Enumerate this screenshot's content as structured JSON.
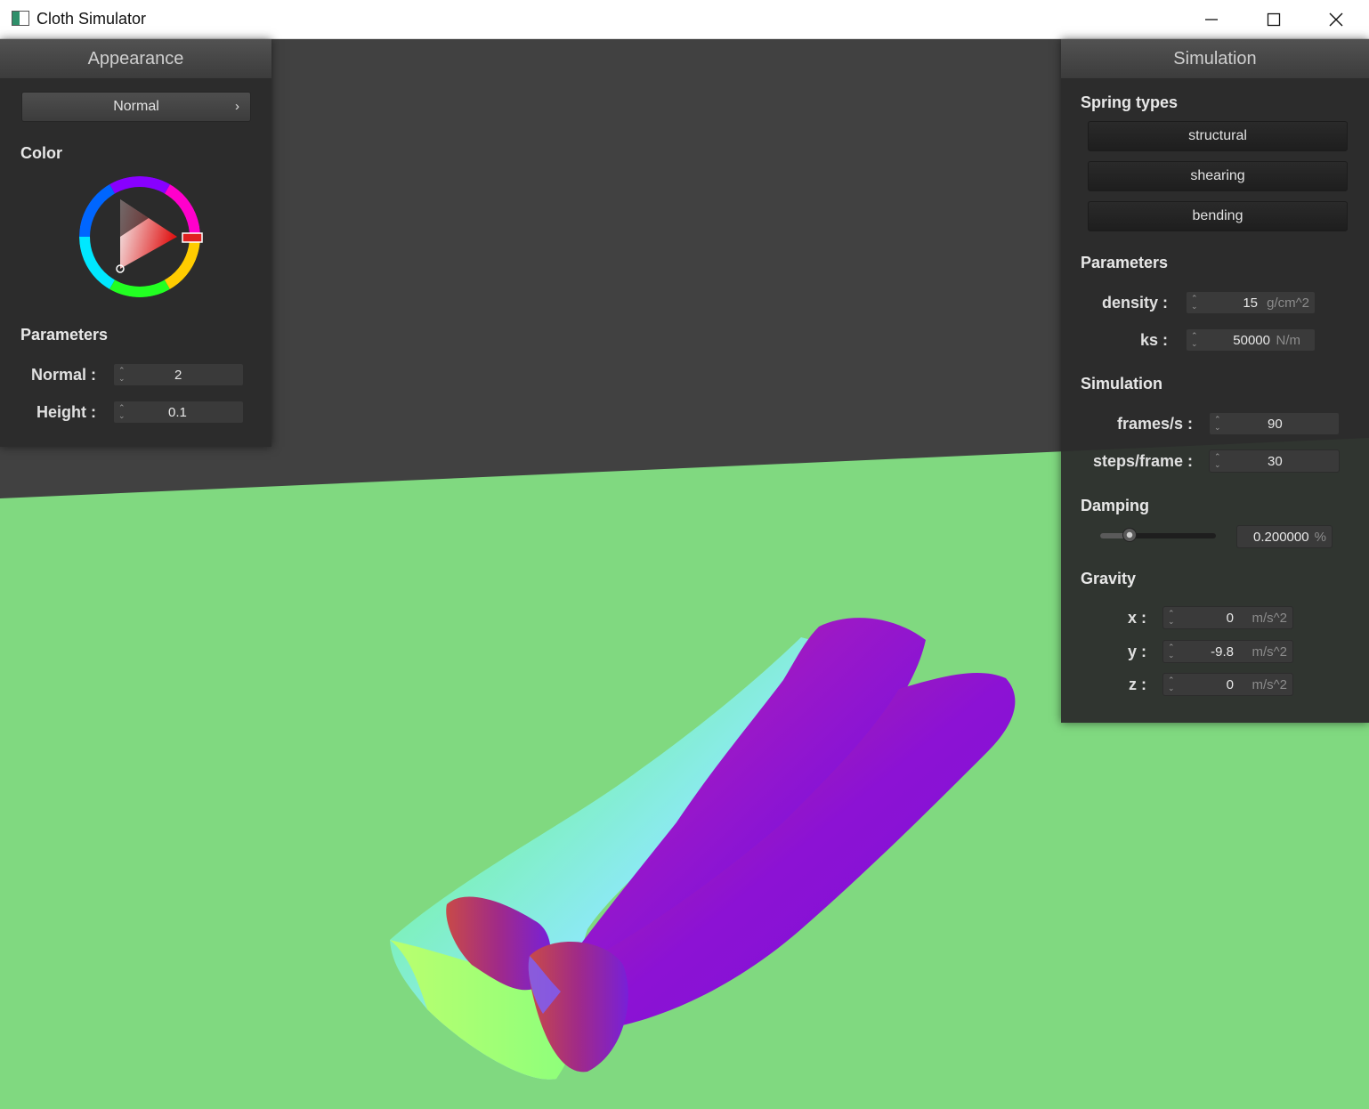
{
  "window": {
    "title": "Cloth Simulator"
  },
  "appearance": {
    "header": "Appearance",
    "shader_select": "Normal",
    "color_label": "Color",
    "parameters_label": "Parameters",
    "normal_label": "Normal :",
    "normal_value": "2",
    "height_label": "Height :",
    "height_value": "0.1"
  },
  "simulation": {
    "header": "Simulation",
    "spring_types_label": "Spring types",
    "springs": [
      "structural",
      "shearing",
      "bending"
    ],
    "parameters_label": "Parameters",
    "density_label": "density :",
    "density_value": "15",
    "density_unit": "g/cm^2",
    "ks_label": "ks :",
    "ks_value": "50000",
    "ks_unit": "N/m",
    "simulation_label": "Simulation",
    "fps_label": "frames/s :",
    "fps_value": "90",
    "steps_label": "steps/frame :",
    "steps_value": "30",
    "damping_label": "Damping",
    "damping_value": "0.200000",
    "damping_unit": "%",
    "damping_slider": 0.2,
    "gravity_label": "Gravity",
    "gx_label": "x :",
    "gx_value": "0",
    "gy_label": "y :",
    "gy_value": "-9.8",
    "gz_label": "z :",
    "gz_value": "0",
    "gravity_unit": "m/s^2"
  },
  "colors": {
    "floor": "#80d980",
    "background": "#414141",
    "selected_color": "#e02020"
  }
}
